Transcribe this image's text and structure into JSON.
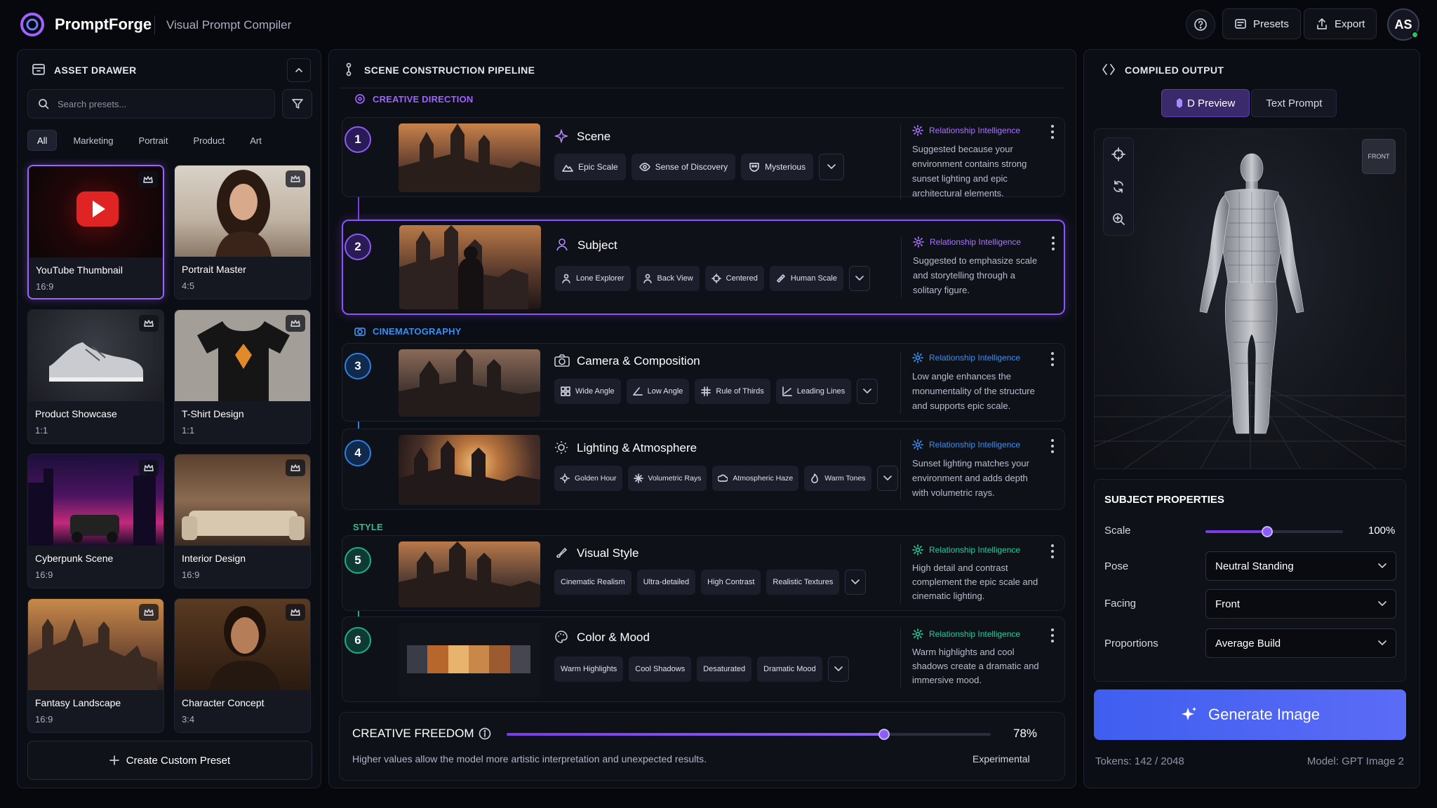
{
  "app": {
    "name": "PromptForge",
    "subtitle": "Visual Prompt Compiler",
    "presets_label": "Presets",
    "export_label": "Export",
    "avatar_initials": "AS"
  },
  "asset_drawer": {
    "title": "ASSET DRAWER",
    "search_placeholder": "Search presets...",
    "tabs": [
      "All",
      "Marketing",
      "Portrait",
      "Product",
      "Art"
    ],
    "cards": [
      {
        "name": "YouTube Thumbnail",
        "ratio": "16:9"
      },
      {
        "name": "Portrait Master",
        "ratio": "4:5"
      },
      {
        "name": "Product Showcase",
        "ratio": "1:1"
      },
      {
        "name": "T-Shirt Design",
        "ratio": "1:1"
      },
      {
        "name": "Cyberpunk Scene",
        "ratio": "16:9"
      },
      {
        "name": "Interior Design",
        "ratio": "16:9"
      },
      {
        "name": "Fantasy Landscape",
        "ratio": "16:9"
      },
      {
        "name": "Character Concept",
        "ratio": "3:4"
      }
    ],
    "create_label": "Create Custom Preset"
  },
  "pipeline": {
    "title": "SCENE CONSTRUCTION PIPELINE",
    "sections": {
      "creative": "CREATIVE DIRECTION",
      "cinema": "CINEMATOGRAPHY",
      "style": "STYLE"
    },
    "intel_label": "Relationship Intelligence",
    "steps": [
      {
        "num": "1",
        "title": "Scene",
        "chips": [
          "Epic Scale",
          "Sense of Discovery",
          "Mysterious"
        ],
        "intel": "Suggested because your environment contains strong sunset lighting and epic architectural elements."
      },
      {
        "num": "2",
        "title": "Subject",
        "chips": [
          "Lone Explorer",
          "Back View",
          "Centered",
          "Human Scale"
        ],
        "intel": "Suggested to emphasize scale and storytelling through a solitary figure."
      },
      {
        "num": "3",
        "title": "Camera & Composition",
        "chips": [
          "Wide Angle",
          "Low Angle",
          "Rule of Thirds",
          "Leading Lines"
        ],
        "intel": "Low angle enhances the monumentality of the structure and supports epic scale."
      },
      {
        "num": "4",
        "title": "Lighting & Atmosphere",
        "chips": [
          "Golden Hour",
          "Volumetric Rays",
          "Atmospheric Haze",
          "Warm Tones"
        ],
        "intel": "Sunset lighting matches your environment and adds depth with volumetric rays."
      },
      {
        "num": "5",
        "title": "Visual Style",
        "chips": [
          "Cinematic Realism",
          "Ultra-detailed",
          "High Contrast",
          "Realistic Textures"
        ],
        "intel": "High detail and contrast complement the epic scale and cinematic lighting."
      },
      {
        "num": "6",
        "title": "Color & Mood",
        "chips": [
          "Warm Highlights",
          "Cool Shadows",
          "Desaturated",
          "Dramatic Mood"
        ],
        "intel": "Warm highlights and cool shadows create a dramatic and immersive mood."
      }
    ],
    "palette": [
      "#3a3d48",
      "#b7672c",
      "#e8b46d",
      "#c9874a",
      "#9b5a30",
      "#45464f"
    ],
    "freedom": {
      "title": "CREATIVE FREEDOM",
      "value": "78%",
      "level": 0.78,
      "description": "Higher values allow the model more artistic interpretation and unexpected results.",
      "mode": "Experimental"
    }
  },
  "output": {
    "title": "COMPILED OUTPUT",
    "tab_preview": "D Preview",
    "tab_text": "Text Prompt",
    "view_label": "FRONT",
    "props_title": "SUBJECT PROPERTIES",
    "scale_label": "Scale",
    "scale_value": "100%",
    "scale_level": 0.45,
    "pose_label": "Pose",
    "pose_value": "Neutral Standing",
    "facing_label": "Facing",
    "facing_value": "Front",
    "proportions_label": "Proportions",
    "proportions_value": "Average Build",
    "generate_label": "Generate Image",
    "tokens": "Tokens: 142 / 2048",
    "model": "Model: GPT Image 2"
  },
  "colors": {
    "accent": "#8b5cf6",
    "blue_step": "#2f7fe0",
    "green_step": "#1fae8c"
  }
}
